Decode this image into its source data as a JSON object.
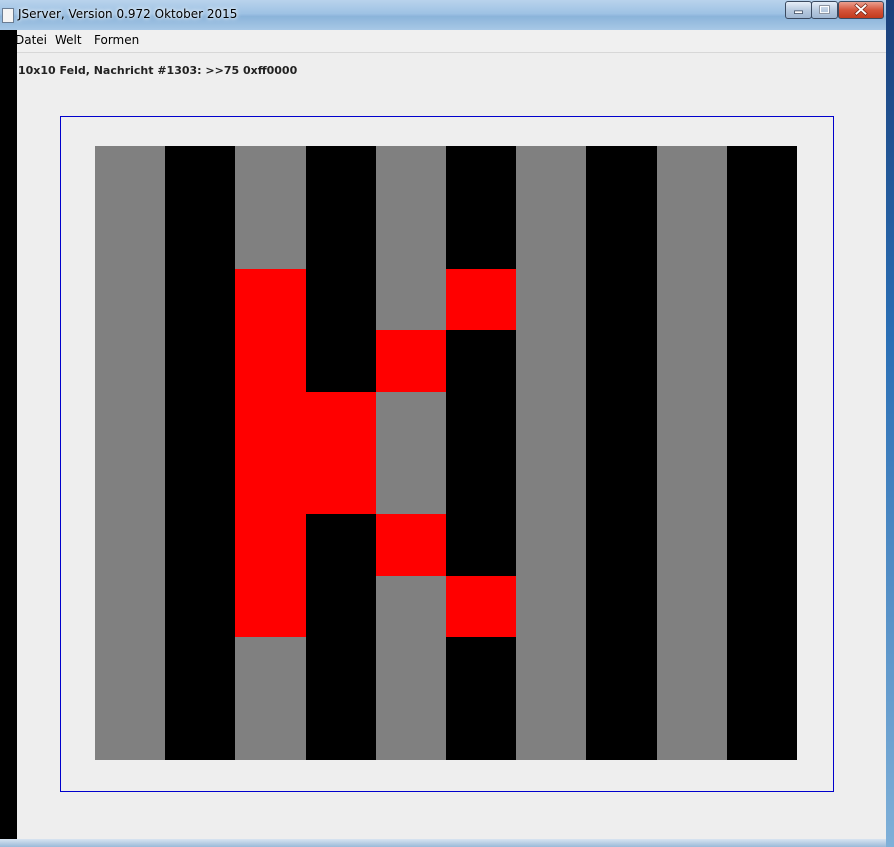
{
  "window": {
    "title": "JServer, Version 0.972 Oktober 2015",
    "controls": {
      "minimize": "minimize",
      "maximize": "maximize",
      "close": "close"
    }
  },
  "menu": {
    "items": [
      {
        "label": "Datei"
      },
      {
        "label": "Welt"
      },
      {
        "label": "Formen"
      }
    ]
  },
  "status": {
    "text": "10x10 Feld, Nachricht #1303: >>75 0xff0000"
  },
  "board": {
    "rows": 10,
    "cols": 10,
    "palette": {
      "G": "#808080",
      "K": "#000000",
      "R": "#ff0000"
    },
    "cells": [
      "GKGKGKGKGK",
      "GKGKGKGKGK",
      "GKRKGRGKGK",
      "GKRKRKGKGK",
      "GKRRGKGKGK",
      "GKRRGKGKGK",
      "GKRKRKGKGK",
      "GKRKGRGKGK",
      "GKGKGKGKGK",
      "GKGKGKGKGK"
    ],
    "frame_color": "#0000cc"
  }
}
